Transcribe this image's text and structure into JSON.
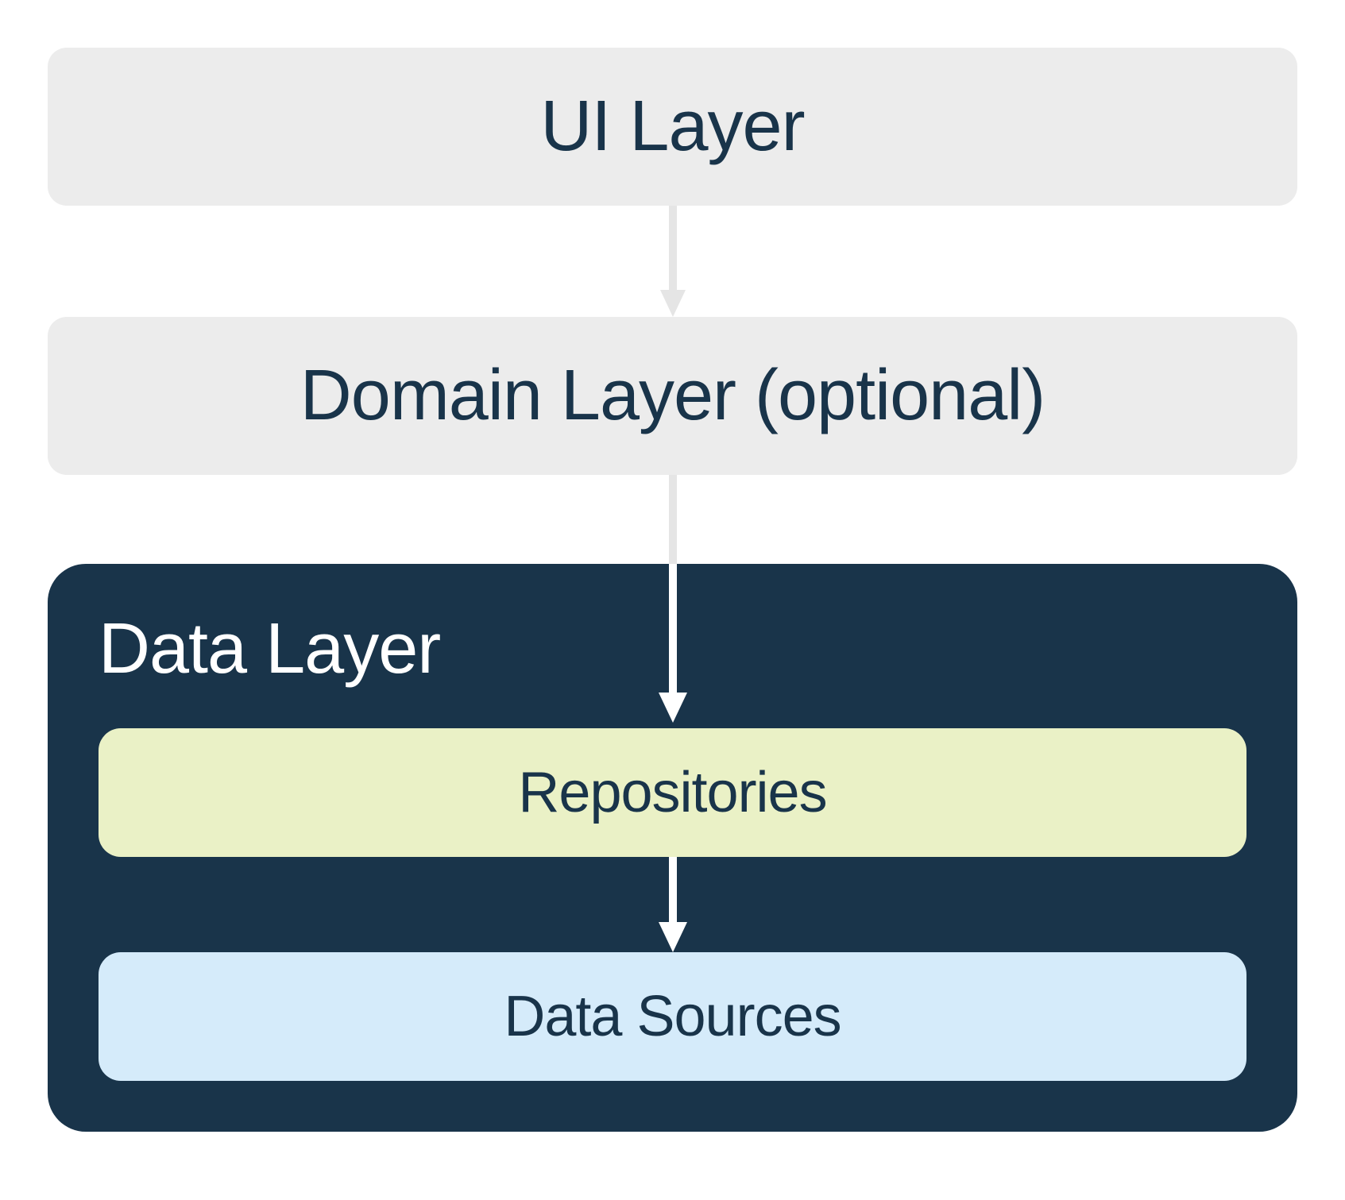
{
  "diagram": {
    "ui_layer": "UI Layer",
    "domain_layer": "Domain Layer (optional)",
    "data_layer": {
      "title": "Data Layer",
      "repositories": "Repositories",
      "data_sources": "Data Sources"
    }
  },
  "colors": {
    "box_light_gray": "#ececec",
    "data_layer_bg": "#19344a",
    "repositories_bg": "#eaf1c6",
    "datasources_bg": "#d5ebfa",
    "text_dark": "#19344a",
    "text_light": "#ffffff",
    "arrow_light": "#e5e5e5",
    "arrow_white": "#ffffff"
  }
}
